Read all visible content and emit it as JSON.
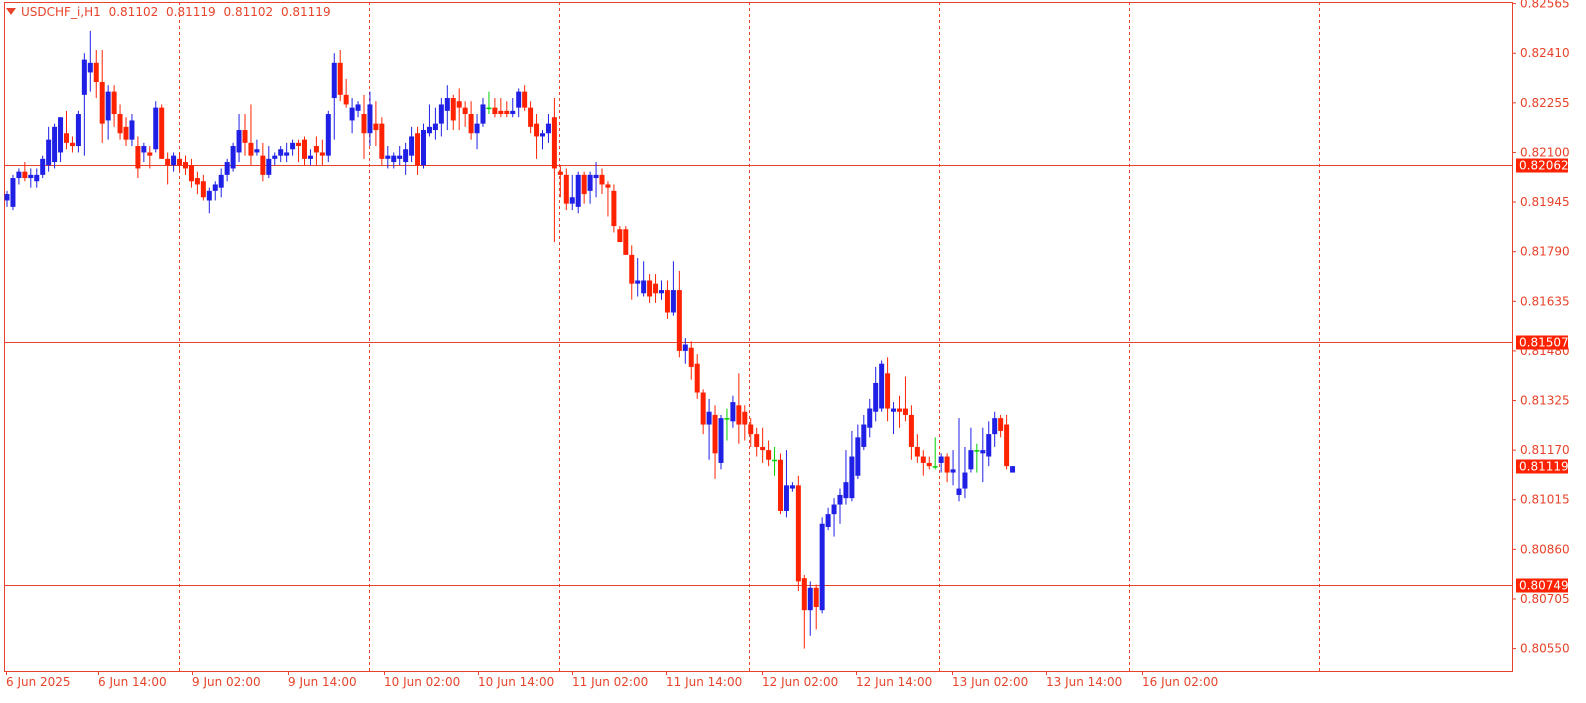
{
  "header": {
    "symbol": "USDCHF_i,H1",
    "open": "0.81102",
    "high": "0.81119",
    "low": "0.81102",
    "close": "0.81119"
  },
  "colors": {
    "background": "#ffffff",
    "frame": "#e8432a",
    "bull": "#1f1fe6",
    "bear": "#ff2200",
    "doji": "#00d000",
    "grid": "#e8432a",
    "axis_text": "#e8432a",
    "hline": "#e8432a",
    "price_tag_bg": "#ff2200",
    "price_tag_text": "#ffffff"
  },
  "chart_data": {
    "type": "candlestick",
    "symbol": "USDCHF_i",
    "timeframe": "H1",
    "ylim": [
      0.8048,
      0.8257
    ],
    "y_ticks": [
      "0.82565",
      "0.82410",
      "0.82255",
      "0.82100",
      "0.81945",
      "0.81790",
      "0.81635",
      "0.81480",
      "0.81325",
      "0.81170",
      "0.81015",
      "0.80860",
      "0.80705",
      "0.80550"
    ],
    "x_ticks": [
      "6 Jun 2025",
      "6 Jun 14:00",
      "9 Jun 02:00",
      "9 Jun 14:00",
      "10 Jun 02:00",
      "10 Jun 14:00",
      "11 Jun 02:00",
      "11 Jun 14:00",
      "12 Jun 02:00",
      "12 Jun 14:00",
      "13 Jun 02:00",
      "13 Jun 14:00",
      "16 Jun 02:00"
    ],
    "horizontal_lines": [
      {
        "price": 0.82062,
        "label": "0.82062"
      },
      {
        "price": 0.81507,
        "label": "0.81507"
      },
      {
        "price": 0.80749,
        "label": "0.80749"
      }
    ],
    "current_price": {
      "price": 0.81119,
      "label": "0.81119"
    },
    "grid": "vertical dashed at session boundaries",
    "candles": [
      {
        "o": 0.8195,
        "h": 0.8198,
        "l": 0.8193,
        "c": 0.8197
      },
      {
        "o": 0.8193,
        "h": 0.8203,
        "l": 0.8192,
        "c": 0.8202
      },
      {
        "o": 0.8202,
        "h": 0.8205,
        "l": 0.82,
        "c": 0.8204
      },
      {
        "o": 0.8204,
        "h": 0.8207,
        "l": 0.8201,
        "c": 0.8202
      },
      {
        "o": 0.8202,
        "h": 0.8205,
        "l": 0.8199,
        "c": 0.8203
      },
      {
        "o": 0.8201,
        "h": 0.8205,
        "l": 0.8199,
        "c": 0.8203
      },
      {
        "o": 0.8203,
        "h": 0.8209,
        "l": 0.8202,
        "c": 0.8208
      },
      {
        "o": 0.8206,
        "h": 0.8218,
        "l": 0.8204,
        "c": 0.8214
      },
      {
        "o": 0.8207,
        "h": 0.8219,
        "l": 0.8205,
        "c": 0.8218
      },
      {
        "o": 0.821,
        "h": 0.8221,
        "l": 0.8207,
        "c": 0.8221
      },
      {
        "o": 0.8216,
        "h": 0.8223,
        "l": 0.8211,
        "c": 0.8213
      },
      {
        "o": 0.8213,
        "h": 0.8215,
        "l": 0.821,
        "c": 0.8212
      },
      {
        "o": 0.8212,
        "h": 0.8223,
        "l": 0.821,
        "c": 0.8222
      },
      {
        "o": 0.8228,
        "h": 0.8241,
        "l": 0.8209,
        "c": 0.8239
      },
      {
        "o": 0.8235,
        "h": 0.8248,
        "l": 0.8229,
        "c": 0.8238
      },
      {
        "o": 0.8238,
        "h": 0.8242,
        "l": 0.8227,
        "c": 0.8232
      },
      {
        "o": 0.8232,
        "h": 0.8242,
        "l": 0.8213,
        "c": 0.8219
      },
      {
        "o": 0.822,
        "h": 0.8231,
        "l": 0.8214,
        "c": 0.8229
      },
      {
        "o": 0.8229,
        "h": 0.8231,
        "l": 0.8218,
        "c": 0.8222
      },
      {
        "o": 0.8222,
        "h": 0.8225,
        "l": 0.8214,
        "c": 0.8216
      },
      {
        "o": 0.8218,
        "h": 0.8221,
        "l": 0.8212,
        "c": 0.8214
      },
      {
        "o": 0.8214,
        "h": 0.8222,
        "l": 0.8212,
        "c": 0.822
      },
      {
        "o": 0.8212,
        "h": 0.8215,
        "l": 0.8202,
        "c": 0.8205
      },
      {
        "o": 0.821,
        "h": 0.8213,
        "l": 0.8207,
        "c": 0.8212
      },
      {
        "o": 0.821,
        "h": 0.8212,
        "l": 0.8205,
        "c": 0.8209
      },
      {
        "o": 0.8211,
        "h": 0.8226,
        "l": 0.821,
        "c": 0.8224
      },
      {
        "o": 0.8224,
        "h": 0.8225,
        "l": 0.8208,
        "c": 0.8208
      },
      {
        "o": 0.8208,
        "h": 0.821,
        "l": 0.82,
        "c": 0.8206
      },
      {
        "o": 0.8206,
        "h": 0.821,
        "l": 0.8204,
        "c": 0.8209
      },
      {
        "o": 0.8208,
        "h": 0.821,
        "l": 0.8204,
        "c": 0.8206
      },
      {
        "o": 0.8207,
        "h": 0.8209,
        "l": 0.8203,
        "c": 0.8205
      },
      {
        "o": 0.8206,
        "h": 0.8208,
        "l": 0.8199,
        "c": 0.8201
      },
      {
        "o": 0.8202,
        "h": 0.8204,
        "l": 0.8197,
        "c": 0.82
      },
      {
        "o": 0.8201,
        "h": 0.8203,
        "l": 0.8195,
        "c": 0.8196
      },
      {
        "o": 0.8195,
        "h": 0.8199,
        "l": 0.8191,
        "c": 0.8198
      },
      {
        "o": 0.8198,
        "h": 0.8201,
        "l": 0.8195,
        "c": 0.82
      },
      {
        "o": 0.8199,
        "h": 0.8205,
        "l": 0.8196,
        "c": 0.8203
      },
      {
        "o": 0.8203,
        "h": 0.8208,
        "l": 0.8201,
        "c": 0.8207
      },
      {
        "o": 0.8205,
        "h": 0.8213,
        "l": 0.8204,
        "c": 0.8212
      },
      {
        "o": 0.821,
        "h": 0.8222,
        "l": 0.8207,
        "c": 0.8217
      },
      {
        "o": 0.8217,
        "h": 0.8222,
        "l": 0.8209,
        "c": 0.8213
      },
      {
        "o": 0.8213,
        "h": 0.8225,
        "l": 0.8206,
        "c": 0.8209
      },
      {
        "o": 0.821,
        "h": 0.8214,
        "l": 0.8209,
        "c": 0.8211
      },
      {
        "o": 0.8209,
        "h": 0.8213,
        "l": 0.8201,
        "c": 0.8203
      },
      {
        "o": 0.8203,
        "h": 0.8212,
        "l": 0.8202,
        "c": 0.8208
      },
      {
        "o": 0.8208,
        "h": 0.821,
        "l": 0.8206,
        "c": 0.8209
      },
      {
        "o": 0.8209,
        "h": 0.8212,
        "l": 0.8207,
        "c": 0.8211
      },
      {
        "o": 0.8209,
        "h": 0.8213,
        "l": 0.8207,
        "c": 0.821
      },
      {
        "o": 0.8211,
        "h": 0.8214,
        "l": 0.8209,
        "c": 0.8213
      },
      {
        "o": 0.8213,
        "h": 0.8214,
        "l": 0.8207,
        "c": 0.8212
      },
      {
        "o": 0.8214,
        "h": 0.8215,
        "l": 0.8206,
        "c": 0.8208
      },
      {
        "o": 0.8208,
        "h": 0.8211,
        "l": 0.8206,
        "c": 0.8209
      },
      {
        "o": 0.8212,
        "h": 0.8215,
        "l": 0.8206,
        "c": 0.821
      },
      {
        "o": 0.821,
        "h": 0.8214,
        "l": 0.8206,
        "c": 0.8209
      },
      {
        "o": 0.8209,
        "h": 0.8223,
        "l": 0.8207,
        "c": 0.8222
      },
      {
        "o": 0.8227,
        "h": 0.8241,
        "l": 0.8214,
        "c": 0.8238
      },
      {
        "o": 0.8238,
        "h": 0.8242,
        "l": 0.8226,
        "c": 0.8228
      },
      {
        "o": 0.8228,
        "h": 0.8233,
        "l": 0.8224,
        "c": 0.8225
      },
      {
        "o": 0.822,
        "h": 0.8227,
        "l": 0.8216,
        "c": 0.8224
      },
      {
        "o": 0.8223,
        "h": 0.8226,
        "l": 0.8221,
        "c": 0.8225
      },
      {
        "o": 0.8222,
        "h": 0.8228,
        "l": 0.8208,
        "c": 0.8216
      },
      {
        "o": 0.8216,
        "h": 0.8229,
        "l": 0.8212,
        "c": 0.8225
      },
      {
        "o": 0.8219,
        "h": 0.8226,
        "l": 0.8212,
        "c": 0.8217
      },
      {
        "o": 0.8219,
        "h": 0.8221,
        "l": 0.8206,
        "c": 0.8208
      },
      {
        "o": 0.8208,
        "h": 0.8212,
        "l": 0.8205,
        "c": 0.8209
      },
      {
        "o": 0.8207,
        "h": 0.821,
        "l": 0.8205,
        "c": 0.8209
      },
      {
        "o": 0.8208,
        "h": 0.8212,
        "l": 0.8206,
        "c": 0.8209
      },
      {
        "o": 0.8207,
        "h": 0.8213,
        "l": 0.8203,
        "c": 0.8211
      },
      {
        "o": 0.8209,
        "h": 0.8218,
        "l": 0.8207,
        "c": 0.8215
      },
      {
        "o": 0.8216,
        "h": 0.8218,
        "l": 0.8203,
        "c": 0.8206
      },
      {
        "o": 0.8206,
        "h": 0.8219,
        "l": 0.8205,
        "c": 0.8217
      },
      {
        "o": 0.8216,
        "h": 0.8225,
        "l": 0.8215,
        "c": 0.8218
      },
      {
        "o": 0.8217,
        "h": 0.8224,
        "l": 0.8214,
        "c": 0.8219
      },
      {
        "o": 0.8219,
        "h": 0.8227,
        "l": 0.8215,
        "c": 0.8225
      },
      {
        "o": 0.8223,
        "h": 0.8231,
        "l": 0.8217,
        "c": 0.8227
      },
      {
        "o": 0.8227,
        "h": 0.8228,
        "l": 0.8217,
        "c": 0.822
      },
      {
        "o": 0.8226,
        "h": 0.823,
        "l": 0.8217,
        "c": 0.8224
      },
      {
        "o": 0.8224,
        "h": 0.8226,
        "l": 0.8218,
        "c": 0.8222
      },
      {
        "o": 0.8222,
        "h": 0.8226,
        "l": 0.8214,
        "c": 0.8216
      },
      {
        "o": 0.8216,
        "h": 0.8222,
        "l": 0.8211,
        "c": 0.8219
      },
      {
        "o": 0.8219,
        "h": 0.8227,
        "l": 0.8218,
        "c": 0.8225
      },
      {
        "o": 0.8224,
        "h": 0.8229,
        "l": 0.8222,
        "c": 0.8224
      },
      {
        "o": 0.8224,
        "h": 0.8227,
        "l": 0.8221,
        "c": 0.8222
      },
      {
        "o": 0.8223,
        "h": 0.8227,
        "l": 0.8221,
        "c": 0.8222
      },
      {
        "o": 0.8223,
        "h": 0.8226,
        "l": 0.8221,
        "c": 0.8222
      },
      {
        "o": 0.8222,
        "h": 0.8227,
        "l": 0.8221,
        "c": 0.8223
      },
      {
        "o": 0.8224,
        "h": 0.823,
        "l": 0.8221,
        "c": 0.8229
      },
      {
        "o": 0.8229,
        "h": 0.8231,
        "l": 0.8223,
        "c": 0.8224
      },
      {
        "o": 0.8224,
        "h": 0.8226,
        "l": 0.8216,
        "c": 0.8218
      },
      {
        "o": 0.8219,
        "h": 0.8222,
        "l": 0.8208,
        "c": 0.8215
      },
      {
        "o": 0.8215,
        "h": 0.8217,
        "l": 0.8211,
        "c": 0.8216
      },
      {
        "o": 0.8216,
        "h": 0.8222,
        "l": 0.8213,
        "c": 0.8219
      },
      {
        "o": 0.8221,
        "h": 0.8227,
        "l": 0.8182,
        "c": 0.8205
      },
      {
        "o": 0.8204,
        "h": 0.8206,
        "l": 0.8196,
        "c": 0.8203
      },
      {
        "o": 0.8203,
        "h": 0.8205,
        "l": 0.8192,
        "c": 0.8194
      },
      {
        "o": 0.8194,
        "h": 0.8203,
        "l": 0.8192,
        "c": 0.8196
      },
      {
        "o": 0.8193,
        "h": 0.8204,
        "l": 0.8191,
        "c": 0.8203
      },
      {
        "o": 0.8203,
        "h": 0.8204,
        "l": 0.8194,
        "c": 0.8197
      },
      {
        "o": 0.8198,
        "h": 0.8204,
        "l": 0.8194,
        "c": 0.8203
      },
      {
        "o": 0.8202,
        "h": 0.8207,
        "l": 0.8196,
        "c": 0.8203
      },
      {
        "o": 0.8203,
        "h": 0.8205,
        "l": 0.8197,
        "c": 0.82
      },
      {
        "o": 0.82,
        "h": 0.8201,
        "l": 0.819,
        "c": 0.8199
      },
      {
        "o": 0.8198,
        "h": 0.82,
        "l": 0.8185,
        "c": 0.8187
      },
      {
        "o": 0.8186,
        "h": 0.8187,
        "l": 0.8182,
        "c": 0.8182
      },
      {
        "o": 0.8186,
        "h": 0.8187,
        "l": 0.8178,
        "c": 0.8178
      },
      {
        "o": 0.8178,
        "h": 0.8181,
        "l": 0.8164,
        "c": 0.8169
      },
      {
        "o": 0.8169,
        "h": 0.8177,
        "l": 0.8165,
        "c": 0.817
      },
      {
        "o": 0.8166,
        "h": 0.8176,
        "l": 0.8165,
        "c": 0.817
      },
      {
        "o": 0.817,
        "h": 0.8172,
        "l": 0.8163,
        "c": 0.8165
      },
      {
        "o": 0.8169,
        "h": 0.8172,
        "l": 0.8163,
        "c": 0.8166
      },
      {
        "o": 0.8166,
        "h": 0.817,
        "l": 0.8164,
        "c": 0.8167
      },
      {
        "o": 0.8167,
        "h": 0.817,
        "l": 0.8158,
        "c": 0.816
      },
      {
        "o": 0.816,
        "h": 0.8176,
        "l": 0.8159,
        "c": 0.8167
      },
      {
        "o": 0.8167,
        "h": 0.8173,
        "l": 0.8146,
        "c": 0.8148
      },
      {
        "o": 0.8148,
        "h": 0.8152,
        "l": 0.8144,
        "c": 0.815
      },
      {
        "o": 0.8149,
        "h": 0.8151,
        "l": 0.8139,
        "c": 0.8143
      },
      {
        "o": 0.8144,
        "h": 0.8147,
        "l": 0.8133,
        "c": 0.8135
      },
      {
        "o": 0.8135,
        "h": 0.8136,
        "l": 0.8122,
        "c": 0.8125
      },
      {
        "o": 0.8125,
        "h": 0.8133,
        "l": 0.8114,
        "c": 0.8129
      },
      {
        "o": 0.8128,
        "h": 0.8131,
        "l": 0.8108,
        "c": 0.8116
      },
      {
        "o": 0.8113,
        "h": 0.8128,
        "l": 0.8111,
        "c": 0.8127
      },
      {
        "o": 0.8127,
        "h": 0.813,
        "l": 0.812,
        "c": 0.8127
      },
      {
        "o": 0.8126,
        "h": 0.8134,
        "l": 0.8124,
        "c": 0.8132
      },
      {
        "o": 0.8131,
        "h": 0.8141,
        "l": 0.8119,
        "c": 0.8125
      },
      {
        "o": 0.8129,
        "h": 0.8131,
        "l": 0.812,
        "c": 0.8125
      },
      {
        "o": 0.8125,
        "h": 0.8127,
        "l": 0.8118,
        "c": 0.8122
      },
      {
        "o": 0.8122,
        "h": 0.8124,
        "l": 0.8115,
        "c": 0.8118
      },
      {
        "o": 0.8118,
        "h": 0.8124,
        "l": 0.8113,
        "c": 0.8117
      },
      {
        "o": 0.8117,
        "h": 0.812,
        "l": 0.8112,
        "c": 0.8114
      },
      {
        "o": 0.8114,
        "h": 0.8118,
        "l": 0.8109,
        "c": 0.8114
      },
      {
        "o": 0.8114,
        "h": 0.8116,
        "l": 0.8097,
        "c": 0.8098
      },
      {
        "o": 0.8098,
        "h": 0.8117,
        "l": 0.8096,
        "c": 0.8106
      },
      {
        "o": 0.8105,
        "h": 0.8107,
        "l": 0.8104,
        "c": 0.8106
      },
      {
        "o": 0.8106,
        "h": 0.8109,
        "l": 0.8073,
        "c": 0.8076
      },
      {
        "o": 0.8077,
        "h": 0.8078,
        "l": 0.8055,
        "c": 0.8067
      },
      {
        "o": 0.8067,
        "h": 0.8076,
        "l": 0.8059,
        "c": 0.8074
      },
      {
        "o": 0.8074,
        "h": 0.8075,
        "l": 0.8061,
        "c": 0.8068
      },
      {
        "o": 0.8067,
        "h": 0.8096,
        "l": 0.8066,
        "c": 0.8094
      },
      {
        "o": 0.8093,
        "h": 0.8099,
        "l": 0.8092,
        "c": 0.8097
      },
      {
        "o": 0.8097,
        "h": 0.8102,
        "l": 0.809,
        "c": 0.81
      },
      {
        "o": 0.81,
        "h": 0.8105,
        "l": 0.8094,
        "c": 0.8103
      },
      {
        "o": 0.8102,
        "h": 0.8117,
        "l": 0.81,
        "c": 0.8107
      },
      {
        "o": 0.8102,
        "h": 0.8123,
        "l": 0.8101,
        "c": 0.8115
      },
      {
        "o": 0.8109,
        "h": 0.8125,
        "l": 0.8108,
        "c": 0.8121
      },
      {
        "o": 0.8118,
        "h": 0.8128,
        "l": 0.8117,
        "c": 0.8125
      },
      {
        "o": 0.8124,
        "h": 0.8133,
        "l": 0.8121,
        "c": 0.813
      },
      {
        "o": 0.8129,
        "h": 0.8143,
        "l": 0.8126,
        "c": 0.8138
      },
      {
        "o": 0.813,
        "h": 0.8145,
        "l": 0.8129,
        "c": 0.8144
      },
      {
        "o": 0.8141,
        "h": 0.8146,
        "l": 0.8126,
        "c": 0.813
      },
      {
        "o": 0.8129,
        "h": 0.8132,
        "l": 0.8122,
        "c": 0.813
      },
      {
        "o": 0.813,
        "h": 0.8134,
        "l": 0.8124,
        "c": 0.8129
      },
      {
        "o": 0.813,
        "h": 0.814,
        "l": 0.8126,
        "c": 0.8128
      },
      {
        "o": 0.8128,
        "h": 0.8131,
        "l": 0.8114,
        "c": 0.8118
      },
      {
        "o": 0.8118,
        "h": 0.8122,
        "l": 0.8113,
        "c": 0.8115
      },
      {
        "o": 0.8115,
        "h": 0.8117,
        "l": 0.8109,
        "c": 0.8113
      },
      {
        "o": 0.8113,
        "h": 0.8115,
        "l": 0.8111,
        "c": 0.8112
      },
      {
        "o": 0.8112,
        "h": 0.8121,
        "l": 0.8111,
        "c": 0.8112
      },
      {
        "o": 0.8113,
        "h": 0.8116,
        "l": 0.811,
        "c": 0.8115
      },
      {
        "o": 0.8115,
        "h": 0.8116,
        "l": 0.8107,
        "c": 0.811
      },
      {
        "o": 0.811,
        "h": 0.8117,
        "l": 0.8106,
        "c": 0.8111
      },
      {
        "o": 0.8103,
        "h": 0.8127,
        "l": 0.8101,
        "c": 0.8105
      },
      {
        "o": 0.8105,
        "h": 0.8118,
        "l": 0.8102,
        "c": 0.811
      },
      {
        "o": 0.8111,
        "h": 0.8124,
        "l": 0.811,
        "c": 0.8117
      },
      {
        "o": 0.8117,
        "h": 0.8119,
        "l": 0.811,
        "c": 0.8117
      },
      {
        "o": 0.8116,
        "h": 0.8124,
        "l": 0.8107,
        "c": 0.8117
      },
      {
        "o": 0.8115,
        "h": 0.8126,
        "l": 0.8112,
        "c": 0.8122
      },
      {
        "o": 0.8122,
        "h": 0.8129,
        "l": 0.8118,
        "c": 0.8127
      },
      {
        "o": 0.8127,
        "h": 0.8128,
        "l": 0.8121,
        "c": 0.8123
      },
      {
        "o": 0.8125,
        "h": 0.8128,
        "l": 0.8111,
        "c": 0.8112
      },
      {
        "o": 0.811,
        "h": 0.8112,
        "l": 0.811,
        "c": 0.8112
      }
    ]
  }
}
